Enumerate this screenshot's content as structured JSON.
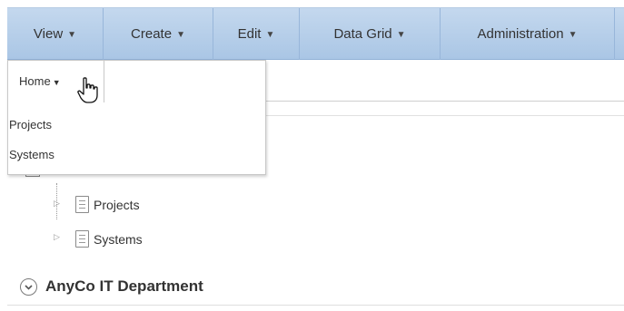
{
  "menubar": {
    "items": [
      {
        "label": "View"
      },
      {
        "label": "Create"
      },
      {
        "label": "Edit"
      },
      {
        "label": "Data Grid"
      },
      {
        "label": "Administration"
      }
    ]
  },
  "dropdown": {
    "header": "Home",
    "items": [
      {
        "label": "Projects"
      },
      {
        "label": "Systems"
      }
    ]
  },
  "tree": {
    "nodes": [
      {
        "label": "Projects"
      },
      {
        "label": "Systems"
      }
    ]
  },
  "region": {
    "title": "AnyCo IT Department"
  },
  "icons": {
    "caret": "caret-down-icon",
    "cursor": "hand-pointer-icon",
    "tree_expand": "triangle-right-icon",
    "document": "document-icon",
    "region_toggle": "chevron-down-circle-icon"
  }
}
